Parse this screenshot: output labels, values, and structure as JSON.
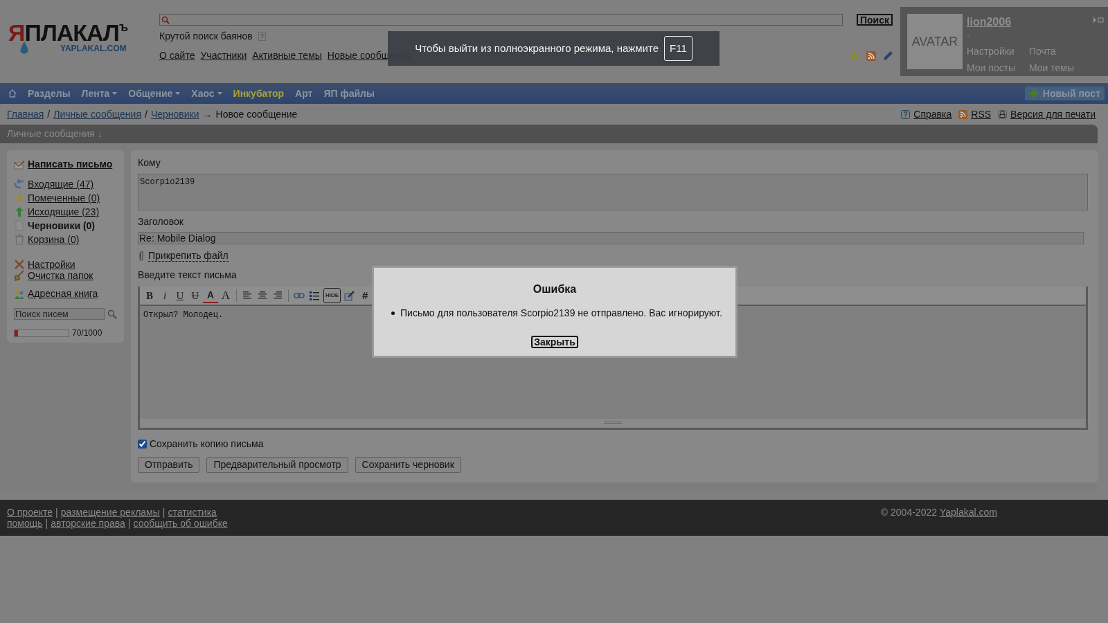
{
  "logo": {
    "first": "Я",
    "rest": "ПЛАКАЛ",
    "mark": "ъ",
    "domain": "YAPLAKAL.COM"
  },
  "header": {
    "search_button": "Поиск",
    "search_hint": "Крутой поиск баянов",
    "hint_badge": "?",
    "links": [
      "О сайте",
      "Участники",
      "Активные темы",
      "Новые сообщения"
    ]
  },
  "user": {
    "avatar": "AVATAR",
    "name": "lion2006",
    "status": "-",
    "links": [
      "Настройки",
      "Почта",
      "Мои посты",
      "Мои темы"
    ]
  },
  "nav": {
    "items": [
      {
        "label": "Разделы",
        "dropdown": false,
        "highlight": false
      },
      {
        "label": "Лента",
        "dropdown": true,
        "highlight": false
      },
      {
        "label": "Общение",
        "dropdown": true,
        "highlight": false
      },
      {
        "label": "Хаос",
        "dropdown": true,
        "highlight": false
      },
      {
        "label": "Инкубатор",
        "dropdown": false,
        "highlight": true
      },
      {
        "label": "Арт",
        "dropdown": false,
        "highlight": false
      },
      {
        "label": "ЯП файлы",
        "dropdown": false,
        "highlight": false
      }
    ],
    "new_post": "Новый пост"
  },
  "breadcrumbs": [
    {
      "kind": "link",
      "text": "Главная"
    },
    {
      "kind": "sep",
      "text": "/"
    },
    {
      "kind": "link",
      "text": "Личные сообщения"
    },
    {
      "kind": "sep",
      "text": "/"
    },
    {
      "kind": "link",
      "text": "Черновики"
    },
    {
      "kind": "sep",
      "text": "→"
    },
    {
      "kind": "current",
      "text": "Новое сообщение"
    }
  ],
  "tools": [
    {
      "kind": "help",
      "label": "Справка"
    },
    {
      "kind": "rss",
      "label": "RSS"
    },
    {
      "kind": "print",
      "label": "Версия для печати"
    }
  ],
  "section_title": "Личные сообщения ↓",
  "sidebar": {
    "compose": "Написать письмо",
    "folders": [
      {
        "kind": "inbox",
        "label": "Входящие (47)",
        "selected": false
      },
      {
        "kind": "star",
        "label": "Помеченные (0)",
        "selected": false
      },
      {
        "kind": "outbox",
        "label": "Исходящие (23)",
        "selected": false
      },
      {
        "kind": "draft",
        "label": "Черновики (0)",
        "selected": true
      },
      {
        "kind": "trash",
        "label": "Корзина (0)",
        "selected": false
      }
    ],
    "tools": [
      {
        "kind": "settings",
        "label": "Настройки"
      },
      {
        "kind": "broom",
        "label": "Очистка папок"
      }
    ],
    "address_book": "Адресная книга",
    "search": {
      "placeholder": "Поиск писем"
    },
    "quota": {
      "level": 0.07,
      "reading": "70/1000"
    }
  },
  "form": {
    "to_label": "Кому",
    "to": "Scorpio2139",
    "subject_label": "Заголовок",
    "subject": "Re: Mobile Dialog",
    "attach": "Прикрепить файл",
    "body_label": "Введите текст письма",
    "toolbar": [
      {
        "kind": "bold",
        "label": "B"
      },
      {
        "kind": "italic",
        "label": "i"
      },
      {
        "kind": "underline",
        "label": "U"
      },
      {
        "kind": "strike",
        "label": "U"
      },
      {
        "kind": "color",
        "label": "A"
      },
      {
        "kind": "size",
        "label": "A"
      },
      {
        "kind": "sep"
      },
      {
        "kind": "align-left"
      },
      {
        "kind": "align-center"
      },
      {
        "kind": "align-right"
      },
      {
        "kind": "sep"
      },
      {
        "kind": "link"
      },
      {
        "kind": "list"
      },
      {
        "kind": "hide",
        "label": "HIDE"
      },
      {
        "kind": "edit"
      },
      {
        "kind": "hash",
        "label": "#"
      }
    ],
    "body": "Открыл? Молодец.",
    "save_copy": {
      "label": "Сохранить копию письма",
      "checked": true
    },
    "buttons": [
      "Отправить",
      "Предварительный просмотр",
      "Сохранить черновик"
    ]
  },
  "footer": {
    "lines": [
      [
        "О проекте",
        "размещение рекламы",
        "статистика"
      ],
      [
        "помощь",
        "авторские права",
        "сообщить об ошибке"
      ]
    ],
    "separator": "|",
    "copyright": "© 2004-2022",
    "site": "Yaplakal.com"
  },
  "dialog": {
    "title": "Ошибка",
    "messages": [
      "Письмо для пользователя Scorpio2139 не отправлено. Вас игнорируют."
    ],
    "button": "Закрыть"
  },
  "fullscreen_notice": {
    "text": "Чтобы выйти из полноэкранного режима, нажмите",
    "key": "F11"
  }
}
